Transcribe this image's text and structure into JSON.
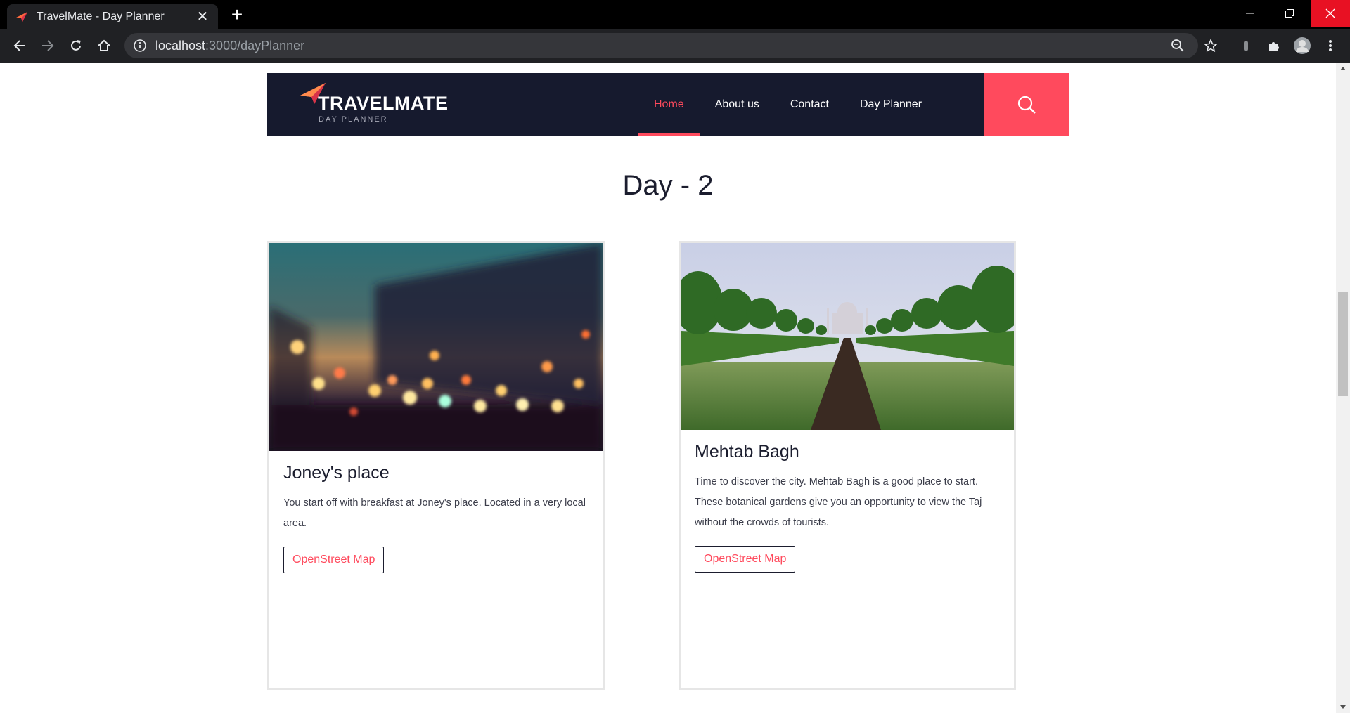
{
  "browser": {
    "tab_title": "TravelMate - Day Planner",
    "url_host": "localhost",
    "url_path": ":3000/dayPlanner"
  },
  "site": {
    "logo_text": "TRAVELMATE",
    "logo_sub": "DAY PLANNER",
    "nav": [
      "Home",
      "About us",
      "Contact",
      "Day Planner"
    ],
    "active_nav": "Home",
    "accent": "#ff4a5d",
    "header_bg": "#161a2e"
  },
  "page": {
    "day_title": "Day - 2",
    "cards": [
      {
        "title": "Joney's place",
        "text": "You start off with breakfast at Joney's place. Located in a very local area.",
        "button": "OpenStreet Map",
        "image": "blurred-city-lights-photo"
      },
      {
        "title": "Mehtab Bagh",
        "text": "Time to discover the city. Mehtab Bagh is a good place to start. These botanical gardens give you an opportunity to view the Taj without the crowds of tourists.",
        "button": "OpenStreet Map",
        "image": "garden-taj-mahal-photo"
      }
    ]
  }
}
